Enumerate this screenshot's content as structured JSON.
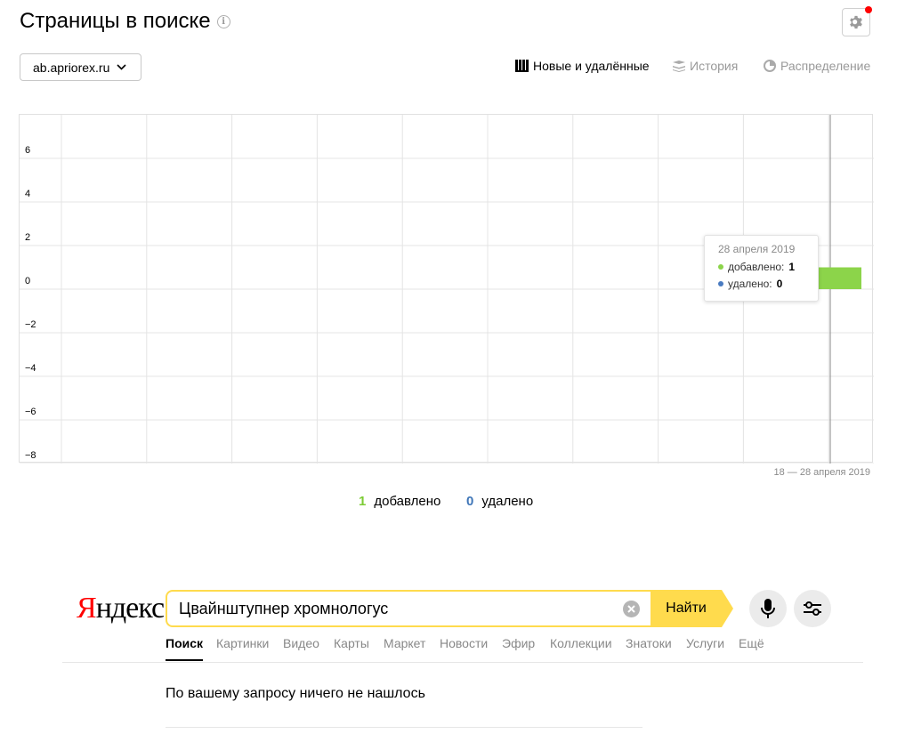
{
  "header": {
    "title": "Страницы в поиске",
    "info_icon": "info-icon",
    "settings_icon": "gear-icon",
    "notification_color": "#ff0000"
  },
  "site_select": {
    "value": "ab.apriorex.ru",
    "icon": "chevron-down-icon"
  },
  "view_tabs": [
    {
      "label": "Новые и удалённые",
      "icon": "bar-chart-icon",
      "active": true
    },
    {
      "label": "История",
      "icon": "layers-icon",
      "active": false
    },
    {
      "label": "Распределение",
      "icon": "pie-icon",
      "active": false
    }
  ],
  "chart_data": {
    "type": "bar",
    "ylim": [
      -8,
      8
    ],
    "yticks": [
      6,
      4,
      2,
      0,
      -2,
      -4,
      -6,
      -8
    ],
    "grid": true,
    "series": [
      {
        "name": "добавлено",
        "color": "#8cd44a",
        "points": [
          {
            "x": "28 апреля 2019",
            "y": 1
          }
        ]
      },
      {
        "name": "удалено",
        "color": "#4a7bc1",
        "points": [
          {
            "x": "28 апреля 2019",
            "y": 0
          }
        ]
      }
    ],
    "date_range": "18 — 28 апреля 2019",
    "tooltip": {
      "date": "28 апреля 2019",
      "added_label": "добавлено:",
      "added_value": "1",
      "removed_label": "удалено:",
      "removed_value": "0"
    }
  },
  "summary": {
    "added_count": "1",
    "added_label": "добавлено",
    "added_color": "#7ccb34",
    "removed_count": "0",
    "removed_label": "удалено",
    "removed_color": "#3f76b8"
  },
  "yandex": {
    "logo_first": "Я",
    "logo_rest": "ндекс",
    "query": "Цвайнштупнер хромнологус",
    "find_label": "Найти",
    "accent_color": "#ffdb4d",
    "mic_icon": "microphone-icon",
    "filter_icon": "sliders-icon",
    "clear_icon": "clear-icon",
    "nav": [
      "Поиск",
      "Картинки",
      "Видео",
      "Карты",
      "Маркет",
      "Новости",
      "Эфир",
      "Коллекции",
      "Знатоки",
      "Услуги",
      "Ещё"
    ],
    "nav_active": "Поиск",
    "no_results": "По вашему запросу ничего не нашлось"
  }
}
